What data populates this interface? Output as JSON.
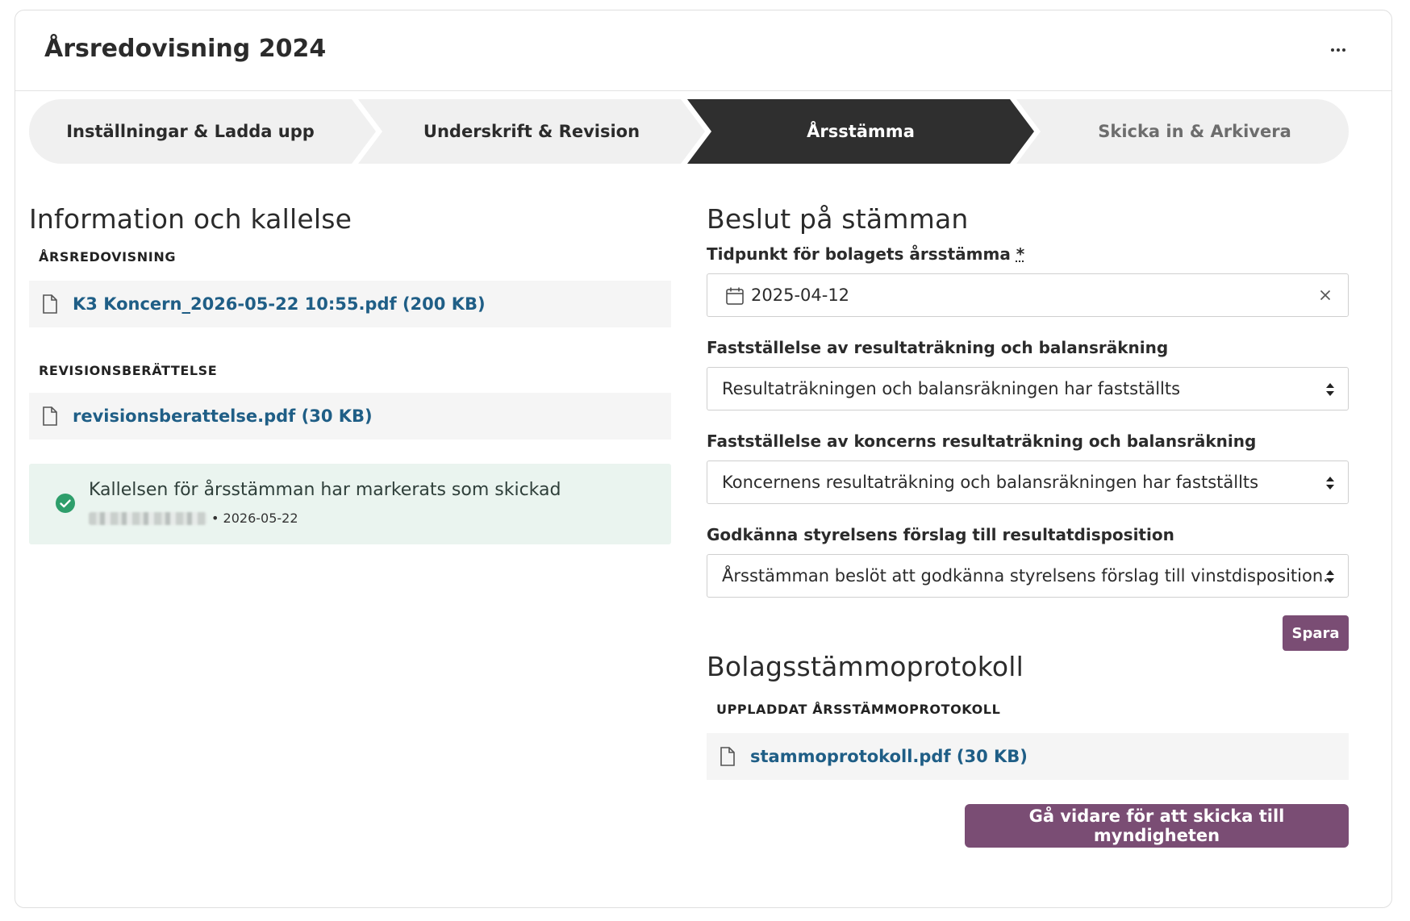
{
  "header": {
    "title": "Årsredovisning 2024",
    "more_icon": "more-horizontal-icon"
  },
  "stepper": {
    "steps": [
      {
        "label": "Inställningar & Ladda upp",
        "state": "done"
      },
      {
        "label": "Underskrift & Revision",
        "state": "done"
      },
      {
        "label": "Årsstämma",
        "state": "active"
      },
      {
        "label": "Skicka in & Arkivera",
        "state": "upcoming"
      }
    ]
  },
  "info": {
    "title": "Information och kallelse",
    "annual_report_label": "ÅRSREDOVISNING",
    "annual_report_file": "K3 Koncern_2026-05-22 10:55.pdf (200 KB)",
    "audit_label": "REVISIONSBERÄTTELSE",
    "audit_file": "revisionsberattelse.pdf (30 KB)",
    "notice": {
      "message": "Kallelsen för årsstämman har markerats som skickad",
      "meta": "• 2026-05-22",
      "status_color": "#2e9e6b"
    }
  },
  "decisions": {
    "title": "Beslut på stämman",
    "date_label": "Tidpunkt för bolagets årsstämma",
    "required_marker": "*",
    "date_value": "2025-04-12",
    "adoption_label": "Fastställelse av resultaträkning och balansräkning",
    "adoption_value": "Resultaträkningen och balansräkningen har fastställts",
    "group_adoption_label": "Fastställelse av koncerns resultaträkning och balansräkning",
    "group_adoption_value": "Koncernens resultaträkning och balansräkningen har fastställts",
    "disposition_label": "Godkänna styrelsens förslag till resultatdisposition",
    "disposition_value": "Årsstämman beslöt att godkänna styrelsens förslag till vinstdisposition.",
    "save_label": "Spara"
  },
  "minutes": {
    "title": "Bolagsstämmoprotokoll",
    "uploaded_label": "UPPLADDAT ÅRSSTÄMMOPROTOKOLL",
    "file": "stammoprotokoll.pdf (30 KB)"
  },
  "footer": {
    "continue_label": "Gå vidare för att skicka till myndigheten"
  },
  "colors": {
    "accent": "#7a4d74",
    "link": "#1f5e86",
    "active_step": "#2f2f2f",
    "notice_bg": "#eaf4ef"
  }
}
